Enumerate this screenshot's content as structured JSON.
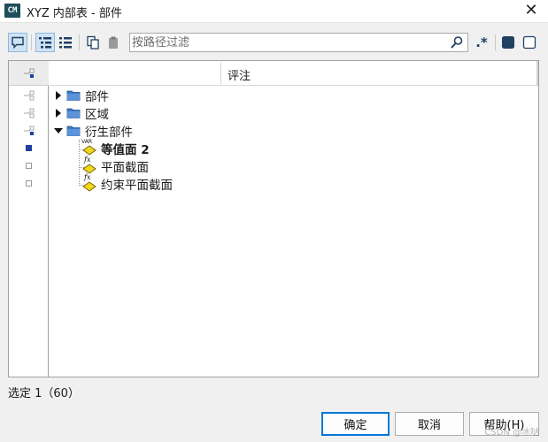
{
  "window": {
    "icon_text": "CM",
    "title": "XYZ 内部表 - 部件",
    "close_glyph": "✕"
  },
  "toolbar": {
    "search_placeholder": "按路径过滤",
    "regex_label": ".*"
  },
  "table": {
    "column_header": "评注"
  },
  "tree": {
    "nodes": [
      {
        "label": "部件",
        "expanded": false,
        "icon": "folder-icon"
      },
      {
        "label": "区域",
        "expanded": false,
        "icon": "folder-icon"
      },
      {
        "label": "衍生部件",
        "expanded": true,
        "icon": "folder-icon"
      },
      {
        "label": "等值面 2",
        "icon": "isosurface-var-icon",
        "var_text": "VAR",
        "bold": true
      },
      {
        "label": "平面截面",
        "icon": "plane-section-fx-icon",
        "fx_text": "fx"
      },
      {
        "label": "约束平面截面",
        "icon": "plane-section-fx-icon",
        "fx_text": "fx"
      }
    ]
  },
  "status": {
    "selection": "选定 1（60）"
  },
  "buttons": {
    "ok": "确定",
    "cancel": "取消",
    "help": "帮助(H)"
  },
  "watermark": "CSDN @冰哒"
}
